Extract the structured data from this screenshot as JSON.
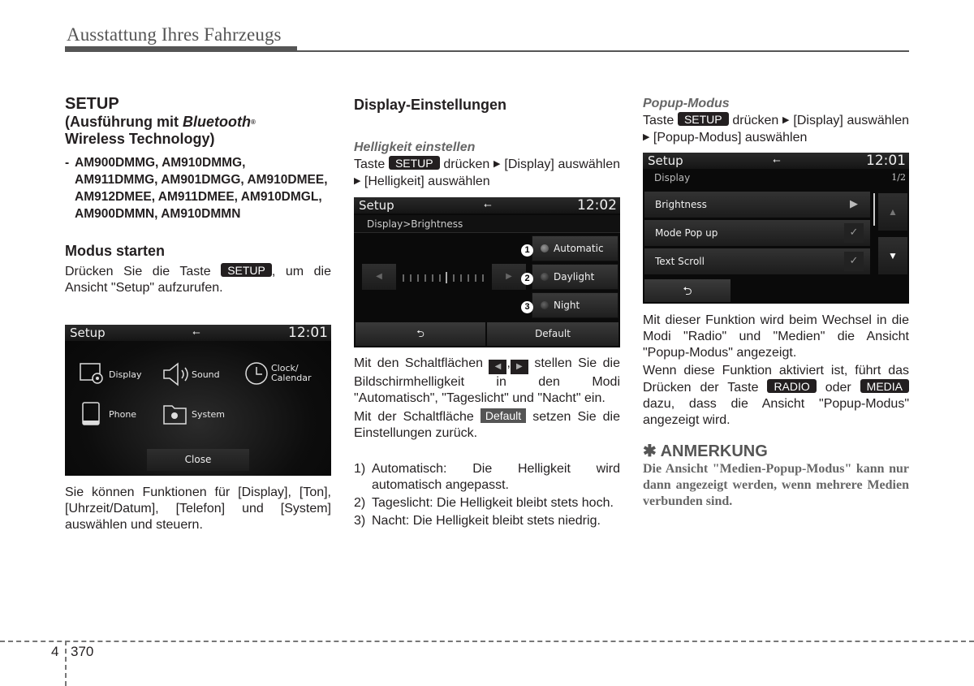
{
  "header": {
    "title": "Ausstattung Ihres Fahrzeugs"
  },
  "col1": {
    "title": "SETUP",
    "subtitle_pre": "(Ausführung mit ",
    "subtitle_brand": "Bluetooth",
    "subtitle_reg": "®",
    "subtitle_post": "Wireless Technology)",
    "models_dash": "-",
    "models": "AM900DMMG, AM910DMMG, AM911DMMG, AM901DMGG, AM910DMEE, AM912DMEE, AM911DMEE, AM910DMGL, AM900DMMN, AM910DMMN",
    "section_title": "Modus starten",
    "start_text_1": "Drücken Sie die Taste ",
    "start_key": "SETUP",
    "start_text_2": ", um die Ansicht \"Setup\" aufzurufen.",
    "screen": {
      "title": "Setup",
      "usb_icon": "usb-icon",
      "time": "12:01",
      "items": [
        {
          "label": "Display",
          "icon": "display-settings-icon"
        },
        {
          "label": "Sound",
          "icon": "speaker-icon"
        },
        {
          "label": "Clock/\nCalendar",
          "icon": "clock-icon"
        },
        {
          "label": "Phone",
          "icon": "phone-icon"
        },
        {
          "label": "System",
          "icon": "system-settings-icon"
        }
      ],
      "close_label": "Close"
    },
    "functions_text": "Sie können Funktionen für [Display], [Ton], [Uhrzeit/Datum], [Telefon] und [System] auswählen und steuern."
  },
  "col2": {
    "title": "Display-Einstellungen",
    "subtitle": "Helligkeit einstellen",
    "path_1": "Taste ",
    "path_key": "SETUP",
    "path_2": " drücken ",
    "path_3": " [Display] auswählen ",
    "path_4": " [Helligkeit] auswählen",
    "arrow": "▶",
    "screen": {
      "title": "Setup",
      "time": "12:02",
      "breadcrumb": "Display>Brightness",
      "modes": [
        {
          "num": "1",
          "label": "Automatic",
          "selected": true
        },
        {
          "num": "2",
          "label": "Daylight",
          "selected": false
        },
        {
          "num": "3",
          "label": "Night",
          "selected": false
        }
      ],
      "brightness_level": 6,
      "brightness_steps": 12,
      "left_arrow": "◀",
      "right_arrow": "▶",
      "back_icon": "⮌",
      "default_label": "Default"
    },
    "buttons_text_1": "Mit den Schaltflächen ",
    "buttons_left": "◀",
    "buttons_sep": ",",
    "buttons_right": "▶",
    "buttons_text_2": " stellen Sie die Bildschirmhelligkeit in den Modi \"Automatisch\", \"Tageslicht\" und \"Nacht\" ein.",
    "default_text_1": "Mit der Schaltfläche ",
    "default_key": "Default",
    "default_text_2": " setzen Sie die Einstellungen zurück.",
    "list": [
      {
        "num": "1)",
        "text": "Automatisch: Die Helligkeit wird automatisch angepasst."
      },
      {
        "num": "2)",
        "text": "Tageslicht: Die Helligkeit bleibt stets hoch."
      },
      {
        "num": "3)",
        "text": "Nacht: Die Helligkeit bleibt stets niedrig."
      }
    ]
  },
  "col3": {
    "subtitle": "Popup-Modus",
    "path_1": "Taste ",
    "path_key": "SETUP",
    "path_2": " drücken ",
    "path_3": " [Display] auswählen ",
    "path_4": " [Popup-Modus] auswählen",
    "arrow": "▶",
    "screen": {
      "title": "Setup",
      "time": "12:01",
      "section": "Display",
      "page": "1/2",
      "rows": [
        {
          "label": "Brightness",
          "indicator": "▶",
          "type": "submenu"
        },
        {
          "label": "Mode Pop up",
          "indicator": "✓",
          "type": "checkbox",
          "checked": true
        },
        {
          "label": "Text Scroll",
          "indicator": "✓",
          "type": "checkbox",
          "checked": true
        }
      ],
      "up_arrow": "▲",
      "down_arrow": "▼",
      "back_icon": "⮌"
    },
    "desc": "Mit dieser Funktion wird beim Wechsel in die Modi \"Radio\" und \"Medien\" die Ansicht \"Popup-Modus\" angezeigt.",
    "active_1": "Wenn diese Funktion aktiviert ist, führt das Drücken der Taste ",
    "radio_key": "RADIO",
    "active_2": " oder ",
    "media_key": "MEDIA",
    "active_3": " dazu, dass die Ansicht \"Popup-Modus\" angezeigt wird.",
    "note_icon": "✱",
    "note_title": "ANMERKUNG",
    "note_text": "Die Ansicht \"Medien-Popup-Modus\" kann nur dann angezeigt werden, wenn mehrere Medien verbunden sind."
  },
  "footer": {
    "chapter": "4",
    "page": "370"
  }
}
